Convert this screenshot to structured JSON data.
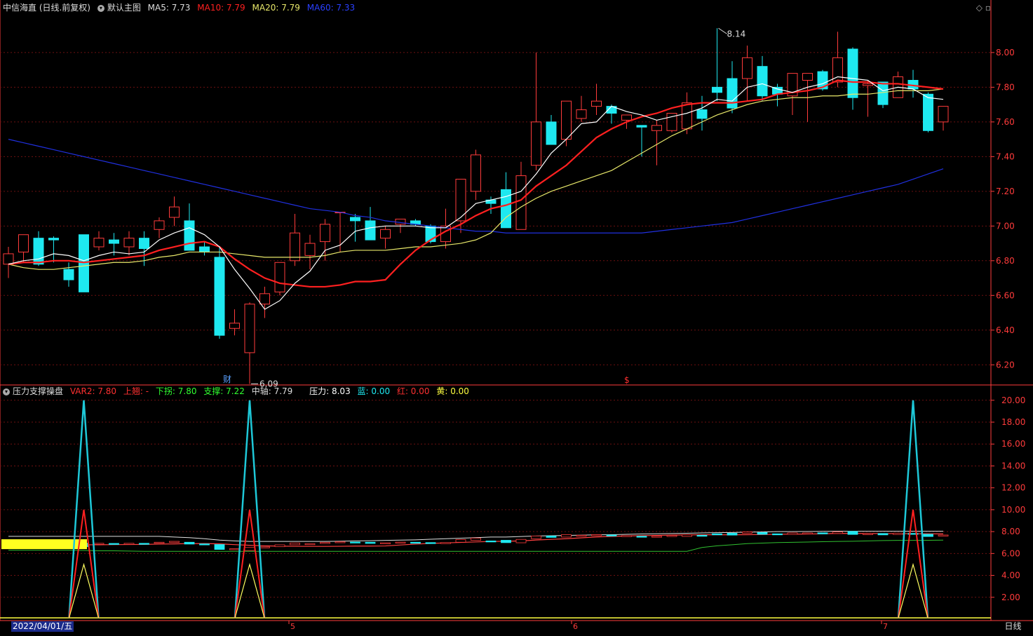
{
  "main_header": {
    "name": "中信海直 (日线.前复权)",
    "indicator": "默认主图",
    "ma5": "MA5: 7.73",
    "ma10": "MA10: 7.79",
    "ma20": "MA20: 7.79",
    "ma60": "MA60: 7.33"
  },
  "sub_header": {
    "indicator": "压力支撑操盘",
    "var2": "VAR2: 7.80",
    "up": "上翘: -",
    "down": "下拐: 7.80",
    "support": "支撑: 7.22",
    "mid": "中轴: 7.79",
    "pressure": "压力: 8.03",
    "blue": "蓝: 0.00",
    "red": "红: 0.00",
    "yellow": "黄: 0.00"
  },
  "annotations": {
    "high": "8.14",
    "low": "6.09",
    "cai": "财",
    "dollar": "$"
  },
  "bottom": {
    "date": "2022/04/01/五",
    "period": "日线"
  },
  "colors": {
    "up": "#ff3b3b",
    "down": "#1ee8f0",
    "ma5": "#ffffff",
    "ma10": "#ff2020",
    "ma20": "#e8e86a",
    "ma60": "#2030e0",
    "grid": "#6e1010",
    "axis": "#ff3b3b"
  },
  "chart_data": [
    {
      "type": "candlestick",
      "y_ticks": [
        "8.00",
        "7.80",
        "7.60",
        "7.40",
        "7.20",
        "7.00",
        "6.80",
        "6.60",
        "6.40",
        "6.20"
      ],
      "ylim": [
        6.1,
        8.23
      ],
      "ohlc": [
        [
          6.78,
          6.88,
          6.7,
          6.84
        ],
        [
          6.85,
          6.95,
          6.79,
          6.95
        ],
        [
          6.93,
          6.97,
          6.77,
          6.78
        ],
        [
          6.93,
          6.94,
          6.79,
          6.92
        ],
        [
          6.75,
          6.79,
          6.65,
          6.69
        ],
        [
          6.95,
          6.95,
          6.62,
          6.62
        ],
        [
          6.88,
          6.97,
          6.86,
          6.93
        ],
        [
          6.92,
          6.96,
          6.83,
          6.9
        ],
        [
          6.88,
          6.97,
          6.83,
          6.93
        ],
        [
          6.93,
          6.97,
          6.77,
          6.87
        ],
        [
          6.98,
          7.05,
          6.93,
          7.03
        ],
        [
          7.05,
          7.17,
          7.0,
          7.11
        ],
        [
          7.03,
          7.13,
          6.87,
          6.86
        ],
        [
          6.88,
          6.91,
          6.83,
          6.85
        ],
        [
          6.82,
          6.88,
          6.35,
          6.37
        ],
        [
          6.41,
          6.52,
          6.37,
          6.44
        ],
        [
          6.27,
          6.56,
          6.09,
          6.55
        ],
        [
          6.55,
          6.65,
          6.47,
          6.61
        ],
        [
          6.62,
          6.79,
          6.6,
          6.79
        ],
        [
          6.8,
          7.07,
          6.77,
          6.96
        ],
        [
          6.83,
          6.95,
          6.75,
          6.9
        ],
        [
          6.91,
          7.04,
          6.8,
          7.01
        ],
        [
          7.08,
          7.08,
          6.85,
          7.08
        ],
        [
          7.05,
          7.07,
          6.91,
          7.03
        ],
        [
          7.03,
          7.11,
          6.94,
          6.92
        ],
        [
          6.93,
          7.0,
          6.87,
          6.98
        ],
        [
          7.01,
          7.04,
          6.96,
          7.04
        ],
        [
          7.03,
          7.04,
          7.0,
          7.01
        ],
        [
          7.0,
          7.01,
          6.9,
          6.91
        ],
        [
          6.91,
          7.1,
          6.87,
          7.0
        ],
        [
          7.03,
          7.26,
          6.96,
          7.27
        ],
        [
          7.2,
          7.44,
          7.15,
          7.41
        ],
        [
          7.15,
          7.17,
          7.07,
          7.13
        ],
        [
          7.21,
          7.31,
          7.0,
          6.99
        ],
        [
          6.98,
          7.37,
          6.98,
          7.29
        ],
        [
          7.35,
          8.0,
          7.32,
          7.6
        ],
        [
          7.6,
          7.64,
          7.47,
          7.47
        ],
        [
          7.5,
          7.72,
          7.46,
          7.72
        ],
        [
          7.62,
          7.75,
          7.6,
          7.67
        ],
        [
          7.69,
          7.82,
          7.64,
          7.72
        ],
        [
          7.69,
          7.7,
          7.59,
          7.65
        ],
        [
          7.61,
          7.61,
          7.56,
          7.64
        ],
        [
          7.58,
          7.58,
          7.4,
          7.57
        ],
        [
          7.55,
          7.61,
          7.35,
          7.58
        ],
        [
          7.55,
          7.65,
          7.54,
          7.65
        ],
        [
          7.56,
          7.77,
          7.53,
          7.71
        ],
        [
          7.67,
          7.75,
          7.55,
          7.62
        ],
        [
          7.8,
          8.14,
          7.72,
          7.77
        ],
        [
          7.85,
          7.95,
          7.65,
          7.68
        ],
        [
          7.85,
          8.04,
          7.72,
          7.97
        ],
        [
          7.92,
          7.98,
          7.72,
          7.75
        ],
        [
          7.8,
          7.82,
          7.69,
          7.76
        ],
        [
          7.75,
          7.88,
          7.64,
          7.88
        ],
        [
          7.84,
          7.87,
          7.6,
          7.88
        ],
        [
          7.89,
          7.9,
          7.78,
          7.79
        ],
        [
          7.83,
          8.12,
          7.8,
          7.97
        ],
        [
          8.02,
          8.03,
          7.67,
          7.74
        ],
        [
          7.81,
          7.84,
          7.63,
          7.82
        ],
        [
          7.83,
          7.83,
          7.68,
          7.7
        ],
        [
          7.74,
          7.89,
          7.76,
          7.86
        ],
        [
          7.84,
          7.9,
          7.74,
          7.79
        ],
        [
          7.76,
          7.77,
          7.54,
          7.55
        ],
        [
          7.6,
          7.66,
          7.55,
          7.69
        ]
      ],
      "ma5": [
        6.78,
        6.8,
        6.81,
        6.84,
        6.83,
        6.8,
        6.83,
        6.85,
        6.84,
        6.85,
        6.92,
        6.96,
        6.99,
        6.95,
        6.88,
        6.75,
        6.64,
        6.52,
        6.57,
        6.67,
        6.74,
        6.86,
        6.89,
        6.97,
        6.99,
        7.0,
        7.0,
        7.0,
        6.99,
        6.99,
        7.05,
        7.13,
        7.15,
        7.17,
        7.2,
        7.3,
        7.42,
        7.5,
        7.59,
        7.6,
        7.69,
        7.66,
        7.64,
        7.61,
        7.63,
        7.65,
        7.68,
        7.73,
        7.72,
        7.8,
        7.82,
        7.79,
        7.77,
        7.8,
        7.82,
        7.86,
        7.85,
        7.84,
        7.78,
        7.8,
        7.79,
        7.74,
        7.73
      ],
      "ma10": [
        6.78,
        6.79,
        6.79,
        6.8,
        6.8,
        6.79,
        6.8,
        6.81,
        6.82,
        6.83,
        6.86,
        6.88,
        6.9,
        6.91,
        6.88,
        6.81,
        6.75,
        6.7,
        6.67,
        6.66,
        6.65,
        6.65,
        6.66,
        6.68,
        6.68,
        6.69,
        6.78,
        6.86,
        6.92,
        6.97,
        7.01,
        7.06,
        7.1,
        7.12,
        7.15,
        7.23,
        7.29,
        7.35,
        7.43,
        7.51,
        7.56,
        7.6,
        7.63,
        7.65,
        7.68,
        7.7,
        7.71,
        7.71,
        7.71,
        7.72,
        7.73,
        7.76,
        7.77,
        7.78,
        7.8,
        7.84,
        7.83,
        7.83,
        7.82,
        7.82,
        7.81,
        7.8,
        7.79
      ],
      "ma20": [
        6.78,
        6.76,
        6.75,
        6.75,
        6.76,
        6.77,
        6.78,
        6.79,
        6.79,
        6.8,
        6.82,
        6.83,
        6.85,
        6.85,
        6.85,
        6.84,
        6.83,
        6.82,
        6.82,
        6.82,
        6.82,
        6.83,
        6.85,
        6.86,
        6.86,
        6.86,
        6.87,
        6.88,
        6.88,
        6.89,
        6.9,
        6.92,
        6.96,
        7.05,
        7.11,
        7.16,
        7.2,
        7.23,
        7.26,
        7.29,
        7.32,
        7.37,
        7.42,
        7.47,
        7.52,
        7.56,
        7.6,
        7.64,
        7.67,
        7.7,
        7.72,
        7.73,
        7.74,
        7.74,
        7.75,
        7.75,
        7.76,
        7.76,
        7.77,
        7.78,
        7.78,
        7.78,
        7.79
      ],
      "ma60": [
        7.5,
        7.48,
        7.46,
        7.44,
        7.42,
        7.4,
        7.38,
        7.36,
        7.34,
        7.32,
        7.3,
        7.28,
        7.26,
        7.24,
        7.22,
        7.2,
        7.18,
        7.16,
        7.14,
        7.12,
        7.1,
        7.09,
        7.08,
        7.06,
        7.05,
        7.03,
        7.02,
        7.01,
        7.0,
        6.99,
        6.98,
        6.97,
        6.97,
        6.96,
        6.96,
        6.96,
        6.96,
        6.96,
        6.96,
        6.96,
        6.96,
        6.96,
        6.96,
        6.97,
        6.98,
        6.99,
        7.0,
        7.01,
        7.02,
        7.04,
        7.06,
        7.08,
        7.1,
        7.12,
        7.14,
        7.16,
        7.18,
        7.2,
        7.22,
        7.24,
        7.27,
        7.3,
        7.33
      ]
    },
    {
      "type": "line",
      "y_ticks": [
        "20.00",
        "18.00",
        "16.00",
        "14.00",
        "12.00",
        "10.00",
        "8.00",
        "6.00",
        "4.00",
        "2.00"
      ],
      "ylim": [
        0,
        20.5
      ],
      "spikes": {
        "index": [
          5,
          16,
          60
        ],
        "blue": 20,
        "red": 10,
        "yellow": 5
      },
      "pressure": [
        7.57,
        7.57,
        7.57,
        7.57,
        7.57,
        7.57,
        7.57,
        7.57,
        7.57,
        7.57,
        7.57,
        7.5,
        7.45,
        7.35,
        7.22,
        7.15,
        7.1,
        7.1,
        7.1,
        7.1,
        7.1,
        7.1,
        7.12,
        7.15,
        7.17,
        7.2,
        7.22,
        7.25,
        7.3,
        7.35,
        7.4,
        7.45,
        7.5,
        7.5,
        7.55,
        7.6,
        7.62,
        7.65,
        7.68,
        7.7,
        7.72,
        7.75,
        7.78,
        7.8,
        7.82,
        7.85,
        7.88,
        7.9,
        7.92,
        7.95,
        7.97,
        8.0,
        8.0,
        8.01,
        8.02,
        8.03,
        8.03,
        8.03,
        8.03,
        8.03,
        8.03,
        8.03,
        8.03
      ],
      "support": [
        6.3,
        6.3,
        6.3,
        6.3,
        6.3,
        6.28,
        6.25,
        6.25,
        6.22,
        6.2,
        6.2,
        6.2,
        6.2,
        6.2,
        6.2,
        6.2,
        6.2,
        6.2,
        6.2,
        6.2,
        6.2,
        6.2,
        6.2,
        6.2,
        6.2,
        6.2,
        6.2,
        6.2,
        6.2,
        6.2,
        6.2,
        6.2,
        6.2,
        6.2,
        6.2,
        6.2,
        6.2,
        6.2,
        6.2,
        6.2,
        6.2,
        6.2,
        6.2,
        6.2,
        6.2,
        6.2,
        6.55,
        6.7,
        6.8,
        6.9,
        6.95,
        7.0,
        7.02,
        7.05,
        7.08,
        7.1,
        7.12,
        7.15,
        7.18,
        7.2,
        7.2,
        7.21,
        7.22
      ]
    }
  ]
}
